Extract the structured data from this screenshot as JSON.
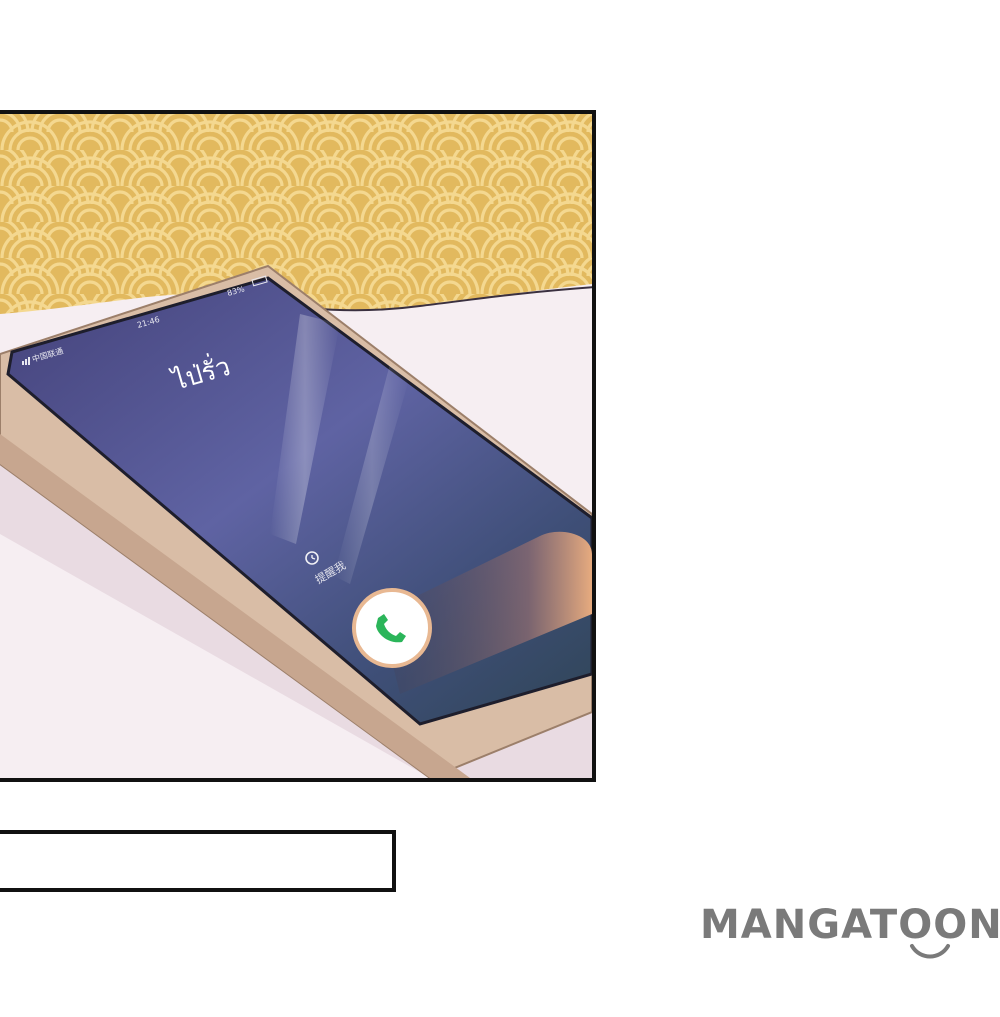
{
  "phone": {
    "carrier": "中国联通",
    "time": "21:46",
    "battery": "83%",
    "contact_name": "ไป่รั่ว",
    "alarm_label": "提醒我"
  },
  "watermark": {
    "brand": "MANGATOON"
  },
  "colors": {
    "pattern_bg": "#e2b95e",
    "pattern_line": "#f3d58c",
    "screen": "#4f4d86",
    "phone_body": "#d8b89c",
    "accept_button": "#2bb55a",
    "brand_grey": "#7a7a7a"
  },
  "icons": [
    "alarm-icon",
    "phone-accept-icon",
    "signal-icon",
    "wifi-icon",
    "battery-icon",
    "smile-icon"
  ]
}
